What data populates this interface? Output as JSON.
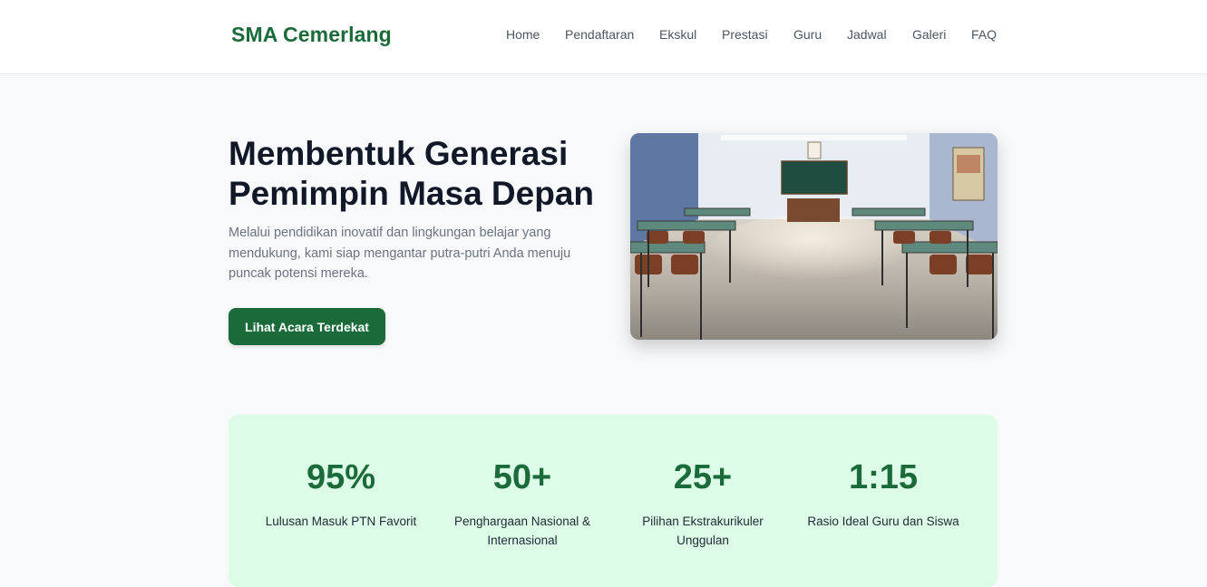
{
  "brand": {
    "name": "SMA Cemerlang"
  },
  "nav": {
    "items": [
      {
        "label": "Home"
      },
      {
        "label": "Pendaftaran"
      },
      {
        "label": "Ekskul"
      },
      {
        "label": "Prestasi"
      },
      {
        "label": "Guru"
      },
      {
        "label": "Jadwal"
      },
      {
        "label": "Galeri"
      },
      {
        "label": "FAQ"
      }
    ]
  },
  "hero": {
    "title": "Membentuk Generasi Pemimpin Masa Depan",
    "subtitle": "Melalui pendidikan inovatif dan lingkungan belajar yang mendukung, kami siap mengantar putra-putri Anda menuju puncak potensi mereka.",
    "cta_label": "Lihat Acara Terdekat"
  },
  "stats": [
    {
      "value": "95%",
      "label": "Lulusan Masuk PTN Favorit"
    },
    {
      "value": "50+",
      "label": "Penghargaan Nasional & Internasional"
    },
    {
      "value": "25+",
      "label": "Pilihan Ekstrakurikuler Unggulan"
    },
    {
      "value": "1:15",
      "label": "Rasio Ideal Guru dan Siswa"
    }
  ],
  "colors": {
    "brand": "#1b6b3a",
    "stats_background": "#dcfce7",
    "page_background": "#f8f9fb"
  }
}
